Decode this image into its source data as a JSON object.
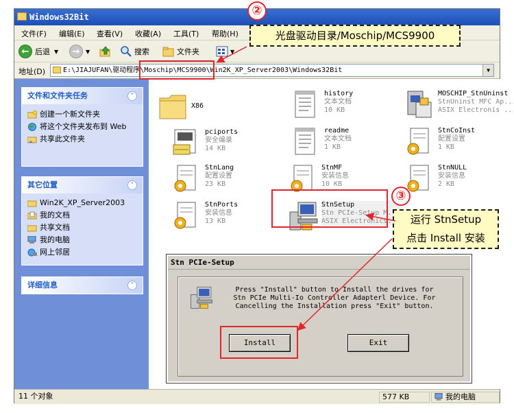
{
  "window": {
    "title": "Windows32Bit",
    "menu": [
      "文件(F)",
      "编辑(E)",
      "查看(V)",
      "收藏(A)",
      "工具(T)",
      "帮助(H)"
    ],
    "toolbar": {
      "back": "后退",
      "search": "搜索",
      "folders": "文件夹"
    },
    "address": {
      "label": "地址(D)",
      "path": "E:\\JIAJUFAN\\驱动程序\\Moschip\\MCS9900\\Win2K_XP_Server2003\\Windows32Bit"
    }
  },
  "sidebar": {
    "tasks": {
      "title": "文件和文件夹任务",
      "items": [
        "创建一个新文件夹",
        "将这个文件夹发布到 Web",
        "共享此文件夹"
      ]
    },
    "other": {
      "title": "其它位置",
      "items": [
        "Win2K_XP_Server2003",
        "我的文档",
        "共享文档",
        "我的电脑",
        "网上邻居"
      ]
    },
    "details": {
      "title": "详细信息"
    }
  },
  "files": [
    {
      "name": "X86",
      "line2": "",
      "line3": "",
      "icon": "folder-icon"
    },
    {
      "name": "history",
      "line2": "文本文档",
      "line3": "10 KB",
      "icon": "text-document-icon"
    },
    {
      "name": "MOSCHIP_StnUninst",
      "line2": "StnUninst MFC Ap...",
      "line3": "ASIX Electronis ...",
      "icon": "uninstaller-icon"
    },
    {
      "name": "pciports",
      "line2": "安全编录",
      "line3": "14 KB",
      "icon": "security-catalog-icon"
    },
    {
      "name": "readme",
      "line2": "文本文档",
      "line3": "1 KB",
      "icon": "text-document-icon"
    },
    {
      "name": "StnCoInst",
      "line2": "配置设置",
      "line3": "1 KB",
      "icon": "config-settings-icon"
    },
    {
      "name": "StnLang",
      "line2": "配置设置",
      "line3": "23 KB",
      "icon": "config-settings-icon"
    },
    {
      "name": "StnMF",
      "line2": "安装信息",
      "line3": "10 KB",
      "icon": "setup-info-icon"
    },
    {
      "name": "StnNULL",
      "line2": "安装信息",
      "line3": "2 KB",
      "icon": "setup-info-icon"
    },
    {
      "name": "StnPorts",
      "line2": "安装信息",
      "line3": "13 KB",
      "icon": "setup-info-icon"
    },
    {
      "name": "StnSetup",
      "line2": "Stn PCIe-Setup M...",
      "line3": "ASIX Electronics...",
      "icon": "setup-program-icon"
    }
  ],
  "status": {
    "count": "11 个对象",
    "size": "577 KB",
    "location": "我的电脑"
  },
  "dialog": {
    "title": "Stn PCIe-Setup",
    "message": "Press \"Install\" button to Install the drives for Stn PCIe Multi-Io Controller Adapterl Device. For Cancelling the Installation press \"Exit\" button.",
    "install_label": "Install",
    "exit_label": "Exit"
  },
  "annotations": {
    "step2_number": "②",
    "step2_text": "光盘驱动目录/Moschip/MCS9900",
    "step3_number": "③",
    "step3_line1": "运行 StnSetup",
    "step3_line2": "点击 Install 安装"
  },
  "colors": {
    "annotation_red": "#e0262b",
    "callout_bg": "#fffbc2",
    "titlebar_blue": "#1c4fb8"
  }
}
